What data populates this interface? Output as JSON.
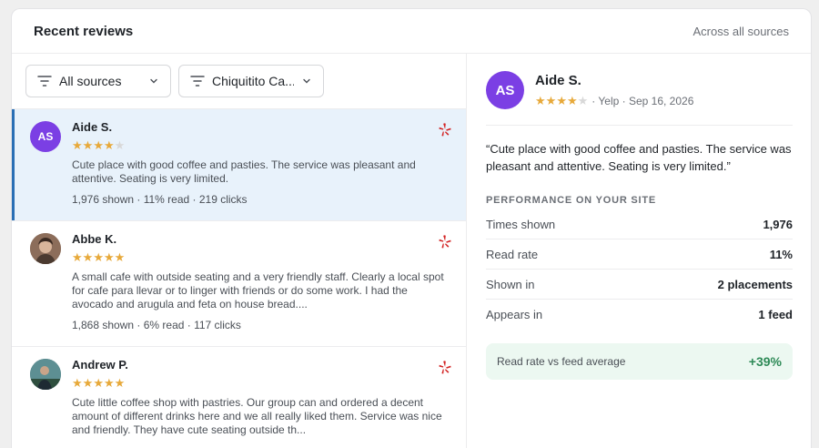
{
  "header": {
    "title": "Recent reviews",
    "subtitle": "Across all sources"
  },
  "filters": {
    "source": "All sources",
    "location": "Chiquitito Ca..."
  },
  "reviews": [
    {
      "initials": "AS",
      "name": "Aide S.",
      "rating": 4,
      "text": "Cute place with good coffee and pasties. The service was pleasant and attentive. Seating is very limited.",
      "meta": "1,976 shown · 11% read · 219 clicks",
      "selected": true
    },
    {
      "initials": "",
      "name": "Abbe K.",
      "rating": 5,
      "text": "A small cafe with outside seating and a very friendly staff. Clearly a local spot for cafe para llevar or to linger with friends or do some work. I had the avocado and arugula and feta on house bread....",
      "meta": "1,868 shown · 6% read · 117 clicks"
    },
    {
      "initials": "",
      "name": "Andrew P.",
      "rating": 5,
      "text": "Cute little coffee shop with pastries. Our group can and ordered a decent amount of different drinks here and we all really liked them. Service was nice and friendly. They have cute seating outside th...",
      "meta": ""
    }
  ],
  "detail": {
    "initials": "AS",
    "name": "Aide S.",
    "rating": 4,
    "source_line": "· Yelp · Sep 16, 2026",
    "quote": "“Cute place with good coffee and pasties. The service was pleasant and attentive. Seating is very limited.”",
    "perf_title": "PERFORMANCE ON YOUR SITE",
    "stats": [
      {
        "label": "Times shown",
        "value": "1,976"
      },
      {
        "label": "Read rate",
        "value": "11%"
      },
      {
        "label": "Shown in",
        "value": "2 placements"
      },
      {
        "label": "Appears in",
        "value": "1 feed"
      }
    ],
    "comparison": {
      "label": "Read rate vs feed average",
      "value": "+39%"
    }
  },
  "colors": {
    "accent": "#2a6fb5",
    "avatar": "#7b3fe4",
    "star": "#e7a93a",
    "yelp": "#d32323",
    "positive": "#2e8a57"
  },
  "icons": [
    "filter-icon",
    "chevron-down-icon",
    "yelp-icon",
    "star-icon"
  ]
}
